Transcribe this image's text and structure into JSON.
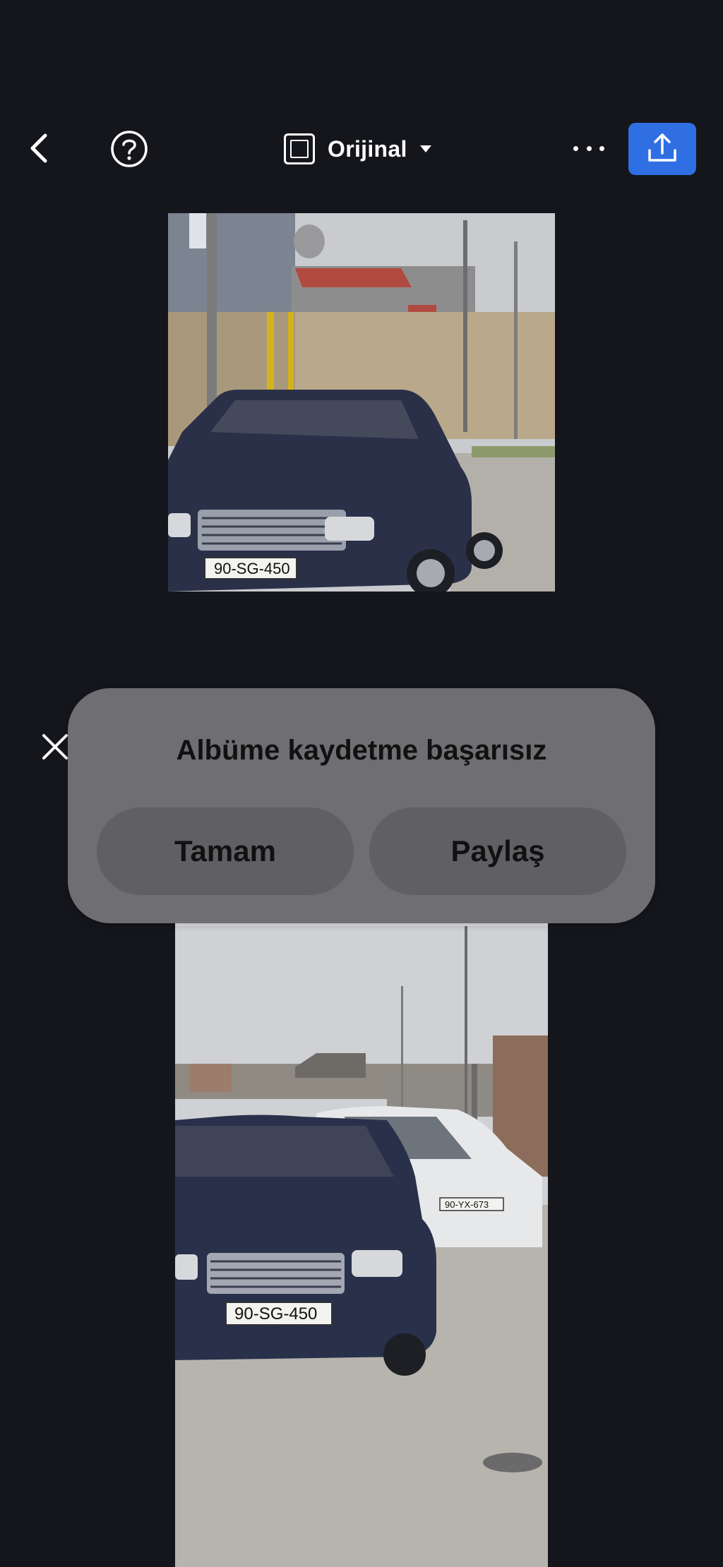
{
  "toolbar": {
    "ratio_label": "Orijinal"
  },
  "icons": {
    "back": "chevron-left-icon",
    "help": "question-circle-icon",
    "ratio": "square-frame-icon",
    "more": "ellipsis-icon",
    "share": "share-upload-icon",
    "close": "close-icon"
  },
  "colors": {
    "background": "#15161b",
    "accent": "#2f6fe3",
    "dialog": "#6f6f73"
  },
  "preview_top": {
    "plate_text": "90-SG-450"
  },
  "preview_bottom": {
    "plate_text": "90-SG-450",
    "plate_text_2": "90-YX-673"
  },
  "dialog": {
    "title": "Albüme kaydetme başarısız",
    "ok_label": "Tamam",
    "share_label": "Paylaş"
  }
}
